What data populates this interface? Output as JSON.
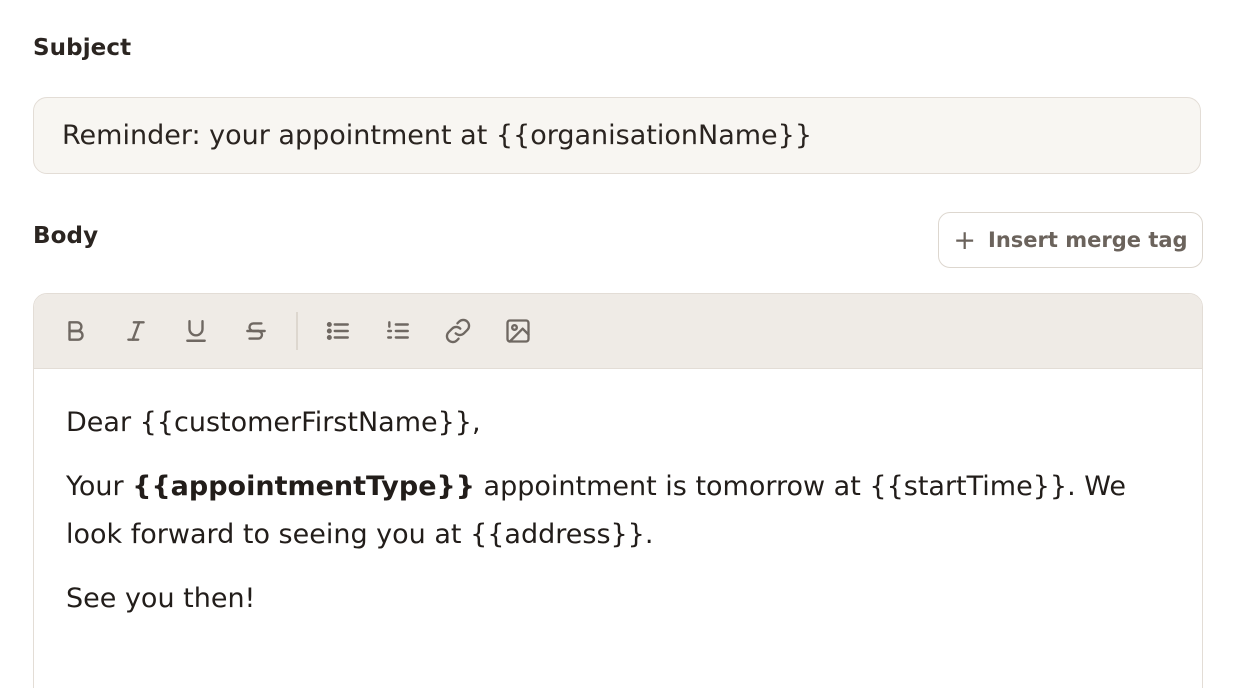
{
  "subject": {
    "label": "Subject",
    "value": "Reminder: your appointment at {{organisationName}}"
  },
  "body": {
    "label": "Body",
    "insert_merge_tag": {
      "icon": "plus-icon",
      "label": "Insert merge tag"
    },
    "toolbar": [
      {
        "icon": "bold-icon",
        "glyph": "B"
      },
      {
        "icon": "italic-icon",
        "glyph": "I"
      },
      {
        "icon": "underline-icon",
        "glyph": "U"
      },
      {
        "icon": "strikethrough-icon",
        "glyph": "S"
      },
      {
        "icon": "bulleted-list-icon"
      },
      {
        "icon": "numbered-list-icon"
      },
      {
        "icon": "link-icon"
      },
      {
        "icon": "image-icon"
      }
    ],
    "content": {
      "greeting": "Dear {{customerFirstName}},",
      "p2_before": "Your ",
      "p2_bold": "{{appointmentType}}",
      "p2_after": " appointment is tomorrow at {{startTime}}. We look forward to seeing you at {{address}}.",
      "closing": "See you then!"
    }
  }
}
